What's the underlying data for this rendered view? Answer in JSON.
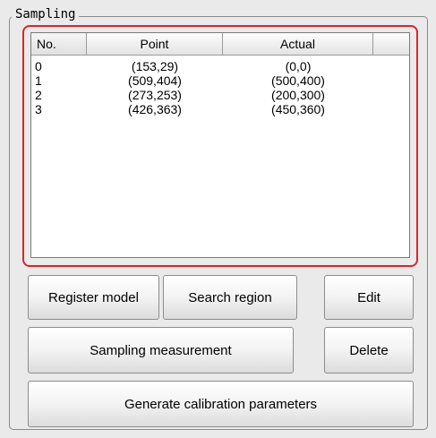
{
  "group": {
    "title": "Sampling"
  },
  "table": {
    "columns": [
      "No.",
      "Point",
      "Actual",
      ""
    ],
    "rows": [
      {
        "no": "0",
        "point": "(153,29)",
        "actual": "(0,0)"
      },
      {
        "no": "1",
        "point": "(509,404)",
        "actual": "(500,400)"
      },
      {
        "no": "2",
        "point": "(273,253)",
        "actual": "(200,300)"
      },
      {
        "no": "3",
        "point": "(426,363)",
        "actual": "(450,360)"
      }
    ]
  },
  "buttons": {
    "register_model": "Register model",
    "search_region": "Search region",
    "edit": "Edit",
    "sampling_measurement": "Sampling measurement",
    "delete": "Delete",
    "generate": "Generate calibration parameters"
  },
  "colors": {
    "highlight": "#d7262b",
    "background": "#eaeaea"
  }
}
